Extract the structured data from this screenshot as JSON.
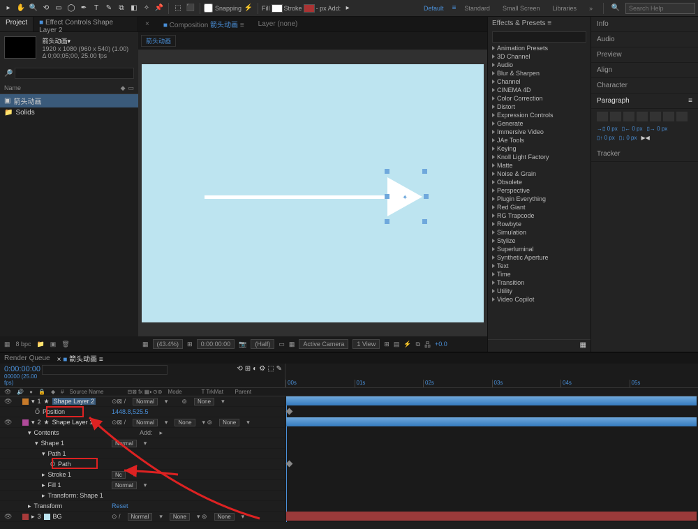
{
  "toolbar": {
    "snapping": "Snapping",
    "fill": "Fill",
    "stroke": "Stroke",
    "stroke_px": "- px",
    "add": "Add:"
  },
  "workspaces": {
    "default": "Default",
    "standard": "Standard",
    "small": "Small Screen",
    "libraries": "Libraries"
  },
  "search_help_placeholder": "Search Help",
  "project": {
    "tab_project": "Project",
    "tab_effect_controls": "Effect Controls Shape Layer 2",
    "comp_title": "箭头动画▾",
    "comp_dims": "1920 x 1080 (960 x 540) (1.00)",
    "comp_dur": "Δ 0;00;05;00, 25.00 fps",
    "search_placeholder": "",
    "col_name": "Name",
    "items": [
      {
        "icon": "comp",
        "name": "箭头动画"
      },
      {
        "icon": "folder",
        "name": "Solids"
      }
    ],
    "bpc": "8 bpc"
  },
  "comp": {
    "tab_controls": "Effect Controls",
    "tab_composition": "Composition",
    "tab_compname": "箭头动画",
    "tab_layer": "Layer (none)",
    "label": "箭头动画"
  },
  "viewer": {
    "magnification": "(43.4%)",
    "timecode": "0:00:00:00",
    "quality": "(Half)",
    "camera": "Active Camera",
    "view": "1 View",
    "exp": "+0.0"
  },
  "effects": {
    "title": "Effects & Presets",
    "search_placeholder": "",
    "categories": [
      "Animation Presets",
      "3D Channel",
      "Audio",
      "Blur & Sharpen",
      "Channel",
      "CINEMA 4D",
      "Color Correction",
      "Distort",
      "Expression Controls",
      "Generate",
      "Immersive Video",
      "JAe Tools",
      "Keying",
      "Knoll Light Factory",
      "Matte",
      "Noise & Grain",
      "Obsolete",
      "Perspective",
      "Plugin Everything",
      "Red Giant",
      "RG Trapcode",
      "Rowbyte",
      "Simulation",
      "Stylize",
      "Superluminal",
      "Synthetic Aperture",
      "Text",
      "Time",
      "Transition",
      "Utility",
      "Video Copilot"
    ]
  },
  "right_panels": {
    "info": "Info",
    "audio": "Audio",
    "preview": "Preview",
    "align": "Align",
    "character": "Character",
    "paragraph": "Paragraph",
    "tracker": "Tracker",
    "px": "0 px"
  },
  "timeline": {
    "tab_render_queue": "Render Queue",
    "tab_comp": "箭头动画",
    "timecode": "0:00:00:00",
    "fps": "00000 (25.00 fps)",
    "search_placeholder": "",
    "ticks": [
      "00s",
      "01s",
      "02s",
      "03s",
      "04s",
      "05s"
    ],
    "cols": {
      "source": "Source Name",
      "mode": "Mode",
      "trkmat": "T  TrkMat",
      "parent": "Parent"
    },
    "layers": [
      {
        "num": "1",
        "color": "orange",
        "name": "Shape Layer 2",
        "mode": "Normal",
        "trkmat": "",
        "parent": "None"
      },
      {
        "prop": "Position",
        "value": "1448.8,525.5",
        "stopwatch": true
      },
      {
        "num": "2",
        "color": "magenta",
        "name": "Shape Layer 1",
        "mode": "Normal",
        "trkmat": "None",
        "parent": "None"
      },
      {
        "group": "Contents",
        "add": "Add:"
      },
      {
        "group": "Shape 1",
        "mode": "Normal"
      },
      {
        "group": "Path 1"
      },
      {
        "prop": "Path",
        "stopwatch": true
      },
      {
        "group": "Stroke 1",
        "mode": "Nc"
      },
      {
        "group": "Fill 1",
        "mode": "Normal"
      },
      {
        "group": "Transform: Shape 1"
      },
      {
        "group": "Transform",
        "reset": "Reset"
      },
      {
        "num": "3",
        "color": "red",
        "name": "BG",
        "mode": "Normal",
        "trkmat": "None",
        "parent": "None"
      }
    ]
  }
}
